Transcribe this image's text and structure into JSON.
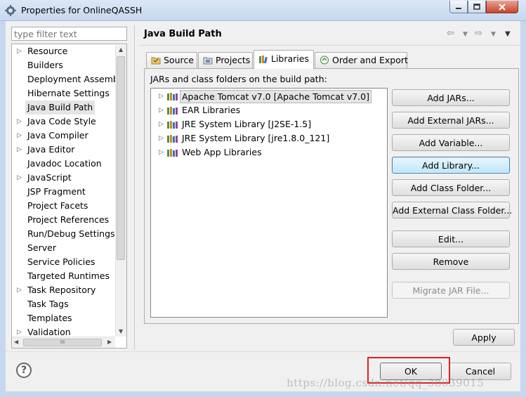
{
  "window": {
    "title": "Properties for OnlineQASSH",
    "icon": "gear-icon",
    "controls": [
      "minimize-icon",
      "maximize-icon",
      "close-icon"
    ]
  },
  "left_pane": {
    "filter_placeholder": "type filter text",
    "tree": [
      {
        "label": "Resource",
        "expandable": true
      },
      {
        "label": "Builders",
        "expandable": false
      },
      {
        "label": "Deployment Assembly",
        "expandable": false
      },
      {
        "label": "Hibernate Settings",
        "expandable": false
      },
      {
        "label": "Java Build Path",
        "expandable": false,
        "selected": true
      },
      {
        "label": "Java Code Style",
        "expandable": true
      },
      {
        "label": "Java Compiler",
        "expandable": true
      },
      {
        "label": "Java Editor",
        "expandable": true
      },
      {
        "label": "Javadoc Location",
        "expandable": false
      },
      {
        "label": "JavaScript",
        "expandable": true
      },
      {
        "label": "JSP Fragment",
        "expandable": false
      },
      {
        "label": "Project Facets",
        "expandable": false
      },
      {
        "label": "Project References",
        "expandable": false
      },
      {
        "label": "Run/Debug Settings",
        "expandable": false
      },
      {
        "label": "Server",
        "expandable": false
      },
      {
        "label": "Service Policies",
        "expandable": false
      },
      {
        "label": "Targeted Runtimes",
        "expandable": false
      },
      {
        "label": "Task Repository",
        "expandable": true
      },
      {
        "label": "Task Tags",
        "expandable": false
      },
      {
        "label": "Templates",
        "expandable": false
      },
      {
        "label": "Validation",
        "expandable": true
      }
    ],
    "hscroll_thumb_grip": "III"
  },
  "right_pane": {
    "title": "Java Build Path",
    "nav_icons": [
      "back-arrow-icon",
      "dropdown-icon",
      "forward-arrow-icon",
      "dropdown-icon",
      "menu-dropdown-icon"
    ],
    "tabs": [
      {
        "label": "Source",
        "icon": "source-folder-icon"
      },
      {
        "label": "Projects",
        "icon": "projects-folder-icon"
      },
      {
        "label": "Libraries",
        "icon": "libraries-icon",
        "active": true
      },
      {
        "label": "Order and Export",
        "icon": "order-export-icon"
      }
    ],
    "list_label": "JARs and class folders on the build path:",
    "libraries": [
      {
        "label": "Apache Tomcat v7.0 [Apache Tomcat v7.0]",
        "selected": true
      },
      {
        "label": "EAR Libraries"
      },
      {
        "label": "JRE System Library [J2SE-1.5]"
      },
      {
        "label": "JRE System Library [jre1.8.0_121]"
      },
      {
        "label": "Web App Libraries"
      }
    ],
    "buttons": {
      "add_jars": "Add JARs...",
      "add_external_jars": "Add External JARs...",
      "add_variable": "Add Variable...",
      "add_library": "Add Library...",
      "add_class_folder": "Add Class Folder...",
      "add_external_class_folder": "Add External Class Folder...",
      "edit": "Edit...",
      "remove": "Remove",
      "migrate_jar": "Migrate JAR File..."
    },
    "apply": "Apply"
  },
  "footer": {
    "help": "?",
    "ok": "OK",
    "cancel": "Cancel"
  },
  "watermark": "https://blog.csdn.net/qq_38039015",
  "colors": {
    "highlight_box": "#e02020",
    "focus_button": "#bee6fd"
  }
}
